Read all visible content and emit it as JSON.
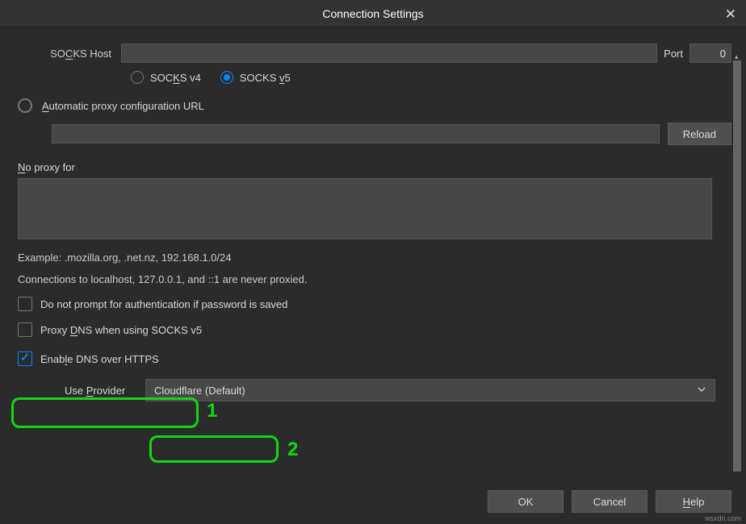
{
  "title": "Connection Settings",
  "socks": {
    "host_label": "SOCKS Host",
    "host_value": "",
    "port_label": "Port",
    "port_value": "0",
    "v4_label": "SOCKS v4",
    "v5_label": "SOCKS v5"
  },
  "auto_url": {
    "label": "Automatic proxy configuration URL",
    "value": "",
    "reload": "Reload"
  },
  "noproxy": {
    "label": "No proxy for",
    "value": "",
    "example": "Example: .mozilla.org, .net.nz, 192.168.1.0/24",
    "local_hint": "Connections to localhost, 127.0.0.1, and ::1 are never proxied."
  },
  "checks": {
    "noprompt": "Do not prompt for authentication if password is saved",
    "proxydns": "Proxy DNS when using SOCKS v5",
    "doh": "Enable DNS over HTTPS"
  },
  "provider": {
    "label": "Use Provider",
    "value": "Cloudflare (Default)"
  },
  "footer": {
    "ok": "OK",
    "cancel": "Cancel",
    "help": "Help"
  },
  "annotations": {
    "one": "1",
    "two": "2"
  },
  "watermark": "wsxdn.com"
}
